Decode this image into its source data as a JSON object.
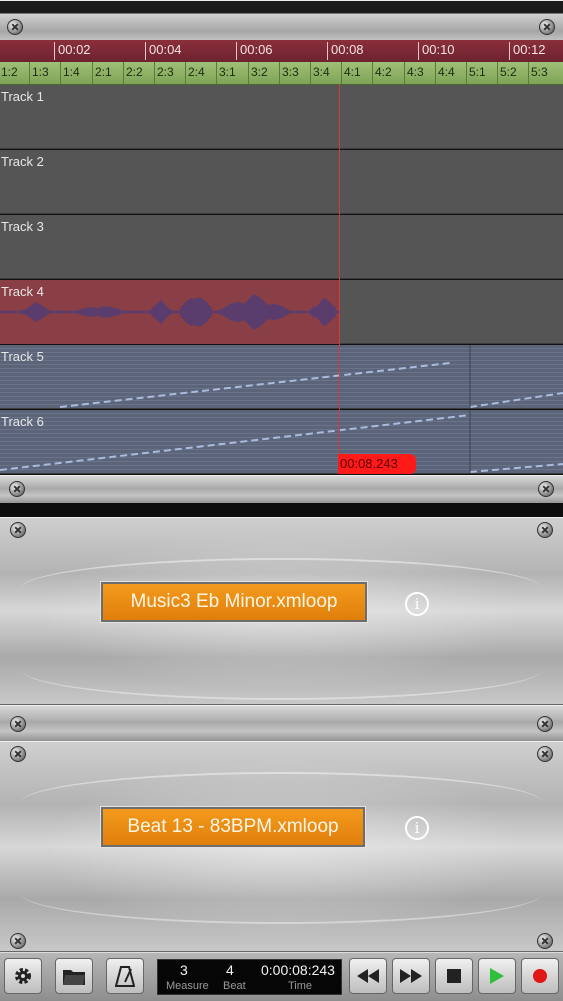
{
  "timeline": {
    "time_ticks": [
      "00:02",
      "00:04",
      "00:06",
      "00:08",
      "00:10",
      "00:12"
    ],
    "beat_ticks": [
      "1:2",
      "1:3",
      "1:4",
      "2:1",
      "2:2",
      "2:3",
      "2:4",
      "3:1",
      "3:2",
      "3:3",
      "3:4",
      "4:1",
      "4:2",
      "4:3",
      "4:4",
      "5:1",
      "5:2",
      "5:3"
    ],
    "playhead_time": "00:08.243"
  },
  "tracks": [
    {
      "label": "Track 1",
      "kind": "empty"
    },
    {
      "label": "Track 2",
      "kind": "empty"
    },
    {
      "label": "Track 3",
      "kind": "empty"
    },
    {
      "label": "Track 4",
      "kind": "audio"
    },
    {
      "label": "Track 5",
      "kind": "midi"
    },
    {
      "label": "Track 6",
      "kind": "midi"
    }
  ],
  "loop_panels": [
    {
      "file": "Music3 Eb Minor.xmloop",
      "info_icon": "i"
    },
    {
      "file": "Beat 13 - 83BPM.xmloop",
      "info_icon": "i"
    }
  ],
  "transport": {
    "measure_value": "3",
    "measure_caption": "Measure",
    "beat_value": "4",
    "beat_caption": "Beat",
    "time_value": "0:00:08:243",
    "time_caption": "Time"
  },
  "icons": {
    "settings": "gear-icon",
    "open": "folder-icon",
    "metronome": "metronome-icon",
    "rewind": "rewind-icon",
    "fast_forward": "fast-forward-icon",
    "stop": "stop-icon",
    "play": "play-icon",
    "record": "record-icon"
  },
  "colors": {
    "time_ruler": "#7a2836",
    "beat_ruler": "#8fb366",
    "audio_region": "#8a3f46",
    "playhead": "#ff1a1a",
    "loop_button": "#f0901a",
    "play_green": "#2fbf3a",
    "record_red": "#e01818"
  }
}
